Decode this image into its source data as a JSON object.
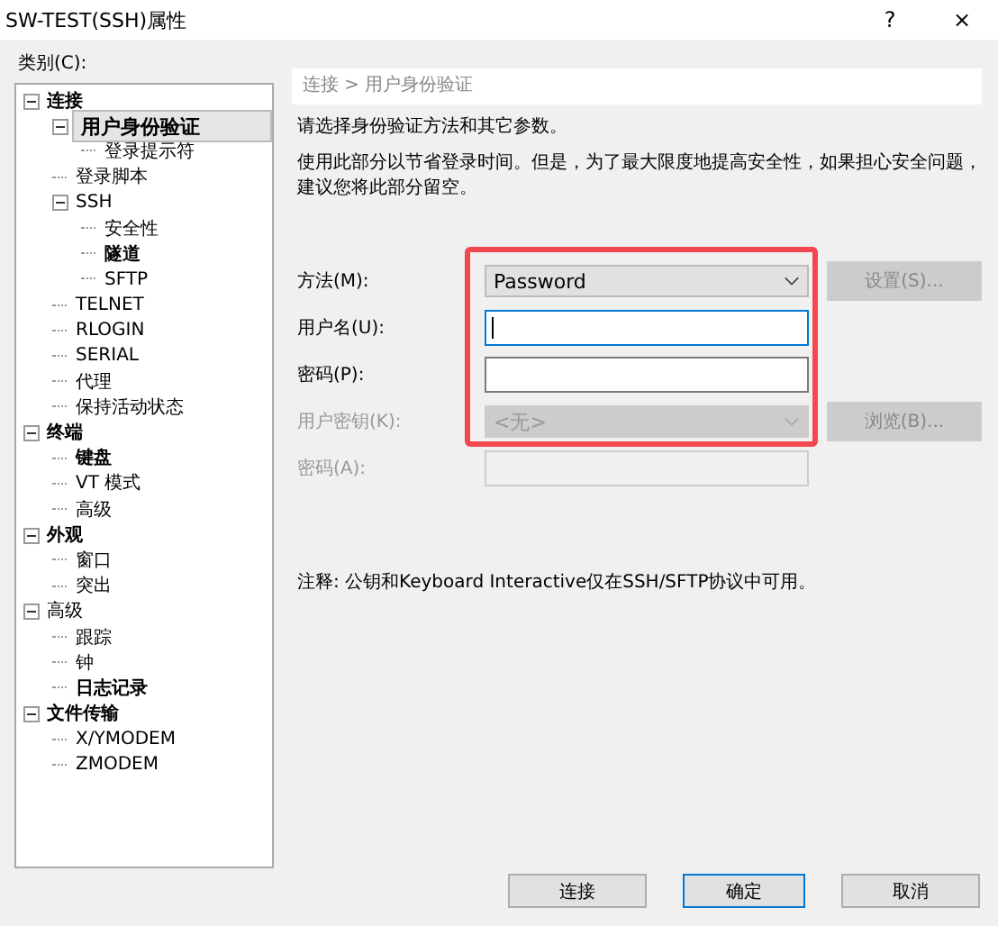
{
  "window": {
    "title": "SW-TEST(SSH)属性",
    "help": "?",
    "close": "×"
  },
  "category_label": "类别(C):",
  "tree": [
    {
      "label": "连接",
      "bold": true,
      "selected": false,
      "expanded": true,
      "children": [
        {
          "label": "用户身份验证",
          "bold": true,
          "selected": true,
          "expanded": true,
          "children": [
            {
              "label": "登录提示符",
              "bold": false,
              "selected": false
            }
          ]
        },
        {
          "label": "登录脚本",
          "bold": false,
          "selected": false
        },
        {
          "label": "SSH",
          "bold": false,
          "selected": false,
          "expanded": true,
          "children": [
            {
              "label": "安全性",
              "bold": false,
              "selected": false
            },
            {
              "label": "隧道",
              "bold": true,
              "selected": false
            },
            {
              "label": "SFTP",
              "bold": false,
              "selected": false
            }
          ]
        },
        {
          "label": "TELNET",
          "bold": false,
          "selected": false
        },
        {
          "label": "RLOGIN",
          "bold": false,
          "selected": false
        },
        {
          "label": "SERIAL",
          "bold": false,
          "selected": false
        },
        {
          "label": "代理",
          "bold": false,
          "selected": false
        },
        {
          "label": "保持活动状态",
          "bold": false,
          "selected": false
        }
      ]
    },
    {
      "label": "终端",
      "bold": true,
      "selected": false,
      "expanded": true,
      "children": [
        {
          "label": "键盘",
          "bold": true,
          "selected": false
        },
        {
          "label": "VT 模式",
          "bold": false,
          "selected": false
        },
        {
          "label": "高级",
          "bold": false,
          "selected": false
        }
      ]
    },
    {
      "label": "外观",
      "bold": true,
      "selected": false,
      "expanded": true,
      "children": [
        {
          "label": "窗口",
          "bold": false,
          "selected": false
        },
        {
          "label": "突出",
          "bold": false,
          "selected": false
        }
      ]
    },
    {
      "label": "高级",
      "bold": false,
      "selected": false,
      "expanded": true,
      "children": [
        {
          "label": "跟踪",
          "bold": false,
          "selected": false
        },
        {
          "label": "钟",
          "bold": false,
          "selected": false
        },
        {
          "label": "日志记录",
          "bold": true,
          "selected": false
        }
      ]
    },
    {
      "label": "文件传输",
      "bold": true,
      "selected": false,
      "expanded": true,
      "children": [
        {
          "label": "X/YMODEM",
          "bold": false,
          "selected": false
        },
        {
          "label": "ZMODEM",
          "bold": false,
          "selected": false
        }
      ]
    }
  ],
  "breadcrumb": "连接 > 用户身份验证",
  "intro": "请选择身份验证方法和其它参数。",
  "description": "使用此部分以节省登录时间。但是，为了最大限度地提高安全性，如果担心安全问题，建议您将此部分留空。",
  "form": [
    {
      "kind": "select",
      "label": "方法(M):",
      "value": "Password",
      "disabled": false,
      "button": {
        "label": "设置(S)...",
        "disabled": true
      }
    },
    {
      "kind": "input",
      "label": "用户名(U):",
      "disabled": false,
      "focused": true
    },
    {
      "kind": "input",
      "label": "密码(P):",
      "disabled": false,
      "focused": false
    },
    {
      "kind": "select",
      "label": "用户密钥(K):",
      "value": "<无>",
      "disabled": true,
      "button": {
        "label": "浏览(B)...",
        "disabled": true
      }
    },
    {
      "kind": "input",
      "label": "密码(A):",
      "disabled": true,
      "focused": false
    }
  ],
  "highlight": true,
  "note": "注释: 公钥和Keyboard Interactive仅在SSH/SFTP协议中可用。",
  "buttons": [
    {
      "label": "连接",
      "default": false
    },
    {
      "label": "确定",
      "default": true
    },
    {
      "label": "取消",
      "default": false
    }
  ]
}
